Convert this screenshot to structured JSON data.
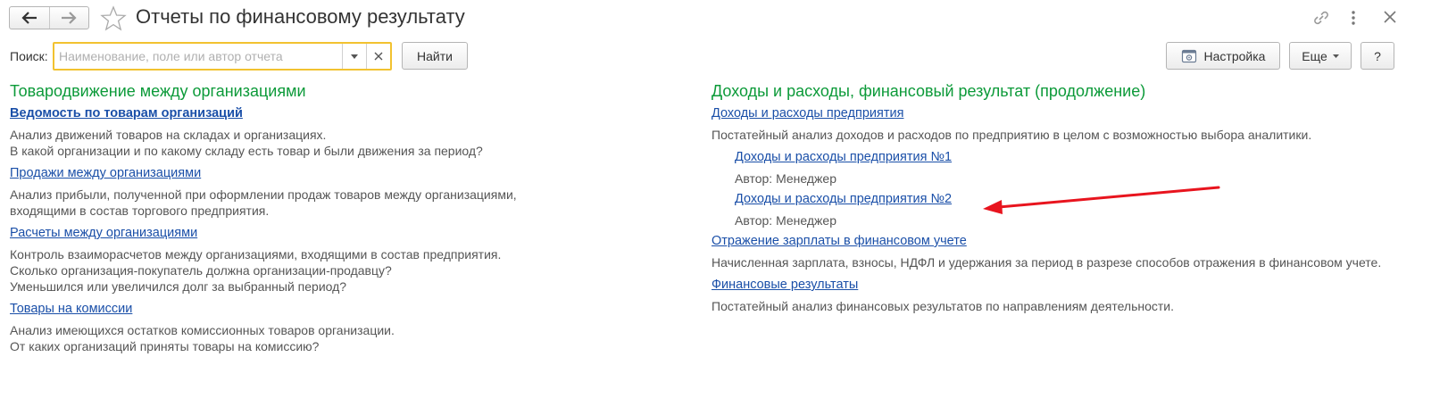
{
  "header": {
    "title": "Отчеты по финансовому результату"
  },
  "search": {
    "label": "Поиск:",
    "placeholder": "Наименование, поле или автор отчета",
    "value": "",
    "find_label": "Найти"
  },
  "toolbar": {
    "settings_label": "Настройка",
    "more_label": "Еще",
    "help_label": "?"
  },
  "left": {
    "heading": "Товародвижение между организациями",
    "reports": [
      {
        "title": "Ведомость по товарам организаций",
        "lines": [
          "Анализ движений товаров на складах и организациях.",
          "В какой организации и по какому складу есть товар и были движения за период?"
        ]
      },
      {
        "title": "Продажи между организациями",
        "lines": [
          "Анализ прибыли, полученной при оформлении продаж товаров между организациями,",
          "входящими в состав торгового предприятия."
        ]
      },
      {
        "title": "Расчеты между организациями",
        "lines": [
          "Контроль взаиморасчетов между организациями, входящими в состав предприятия.",
          "Сколько организация-покупатель должна организации-продавцу?",
          "Уменьшился или увеличился долг за выбранный период?"
        ]
      },
      {
        "title": "Товары на комиссии",
        "lines": [
          "Анализ имеющихся остатков комиссионных товаров организации.",
          "От каких организаций приняты товары на комиссию?"
        ]
      }
    ]
  },
  "right": {
    "heading": "Доходы и расходы, финансовый результат (продолжение)",
    "report_main": {
      "title": "Доходы и расходы предприятия",
      "desc": "Постатейный анализ доходов и расходов по предприятию в целом с возможностью выбора аналитики."
    },
    "variants": [
      {
        "title": "Доходы и расходы предприятия  №1",
        "author": "Автор: Менеджер"
      },
      {
        "title": "Доходы и расходы предприятия  №2",
        "author": "Автор: Менеджер"
      }
    ],
    "report_salary": {
      "title": "Отражение зарплаты в финансовом учете",
      "desc": "Начисленная зарплата, взносы, НДФЛ и удержания за период в разрезе способов отражения в финансовом учете."
    },
    "report_fin": {
      "title": "Финансовые результаты",
      "desc": "Постатейный анализ финансовых результатов по направлениям деятельности."
    }
  },
  "colors": {
    "heading": "#0c9a39",
    "link": "#1a4fa8",
    "search_border": "#f2c230",
    "arrow": "#e8141e"
  }
}
